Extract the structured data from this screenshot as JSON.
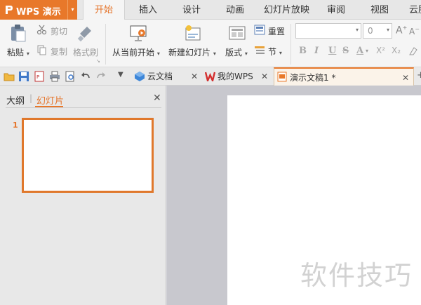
{
  "app": {
    "title": "WPS 演示"
  },
  "menu": {
    "tabs": [
      "开始",
      "插入",
      "设计",
      "动画",
      "幻灯片放映",
      "审阅",
      "视图",
      "云服"
    ],
    "active": "开始"
  },
  "ribbon": {
    "paste": "粘贴",
    "cut": "剪切",
    "copy": "复制",
    "format_painter": "格式刷",
    "from_current": "从当前开始",
    "new_slide": "新建幻灯片",
    "layout": "版式",
    "reset": "重置",
    "section": "节",
    "font_size": "0",
    "format_buttons": [
      "B",
      "I",
      "U",
      "S",
      "A",
      "X²",
      "X₂"
    ]
  },
  "doc_tabs": [
    {
      "label": "云文档",
      "icon": "cloud-doc-icon"
    },
    {
      "label": "我的WPS",
      "icon": "wps-logo-icon"
    },
    {
      "label": "演示文稿1 *",
      "icon": "presentation-file-icon"
    }
  ],
  "left_pane": {
    "tabs": [
      "大纲",
      "幻灯片"
    ],
    "active_tab": "幻灯片",
    "slide_number": "1"
  },
  "watermark": "软件技巧",
  "colors": {
    "accent": "#e8782a",
    "active_tab_text": "#e5742a"
  }
}
